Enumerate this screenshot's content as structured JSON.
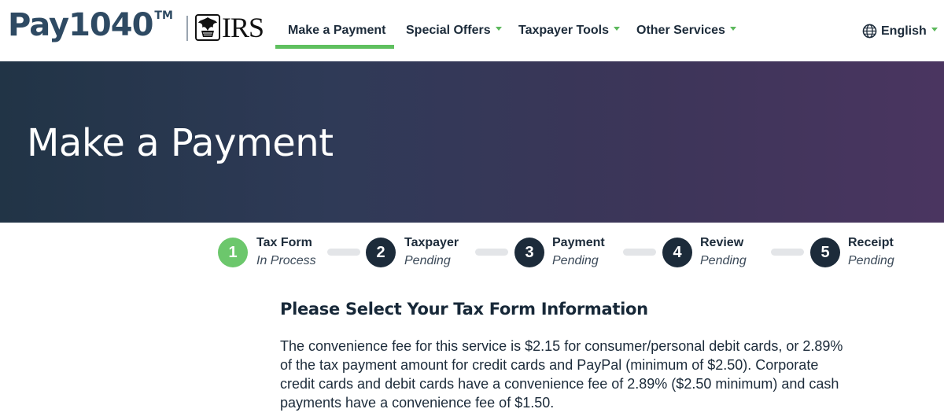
{
  "header": {
    "brand": "Pay1040",
    "brand_tm": "TM",
    "partner": "IRS",
    "nav": [
      {
        "label": "Make a Payment",
        "active": true,
        "has_dropdown": false
      },
      {
        "label": "Special Offers",
        "active": false,
        "has_dropdown": true
      },
      {
        "label": "Taxpayer Tools",
        "active": false,
        "has_dropdown": true
      },
      {
        "label": "Other Services",
        "active": false,
        "has_dropdown": true
      }
    ],
    "language": {
      "label": "English",
      "icon": "globe-icon"
    }
  },
  "hero": {
    "title": "Make a Payment"
  },
  "steps": [
    {
      "number": "1",
      "title": "Tax Form",
      "status": "In Process",
      "active": true
    },
    {
      "number": "2",
      "title": "Taxpayer",
      "status": "Pending",
      "active": false
    },
    {
      "number": "3",
      "title": "Payment",
      "status": "Pending",
      "active": false
    },
    {
      "number": "4",
      "title": "Review",
      "status": "Pending",
      "active": false
    },
    {
      "number": "5",
      "title": "Receipt",
      "status": "Pending",
      "active": false
    }
  ],
  "content": {
    "title": "Please Select Your Tax Form Information",
    "body": "The convenience fee for this service is $2.15 for consumer/personal debit cards, or 2.89% of the tax payment amount for credit cards and PayPal (minimum of $2.50). Corporate credit cards and debit cards have a convenience fee of 2.89% ($2.50 minimum) and cash payments have a convenience fee of $1.50."
  },
  "colors": {
    "accent_green": "#5fc05f",
    "navy": "#1c2b3a",
    "hero_start": "#213446",
    "hero_end": "#4a3560"
  }
}
